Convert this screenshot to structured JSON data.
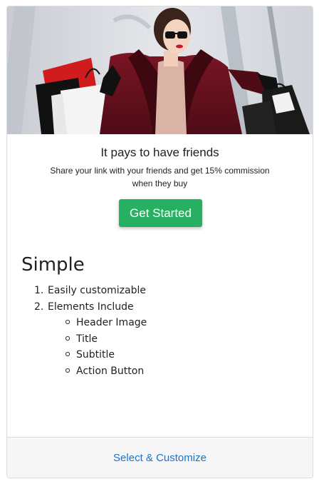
{
  "hero": {
    "image_name": "header-image"
  },
  "promo": {
    "title": "It pays to have friends",
    "subtitle": "Share your link with your friends and get 15% commission when they buy",
    "cta_label": "Get Started",
    "cta_color": "#28b062"
  },
  "description": {
    "heading": "Simple",
    "items": [
      {
        "number": "1.",
        "label": "Easily customizable"
      },
      {
        "number": "2.",
        "label": "Elements Include"
      }
    ],
    "sub_items": [
      "Header Image",
      "Title",
      "Subtitle",
      "Action Button"
    ]
  },
  "footer": {
    "link_label": "Select & Customize",
    "link_color": "#1a73c8"
  }
}
